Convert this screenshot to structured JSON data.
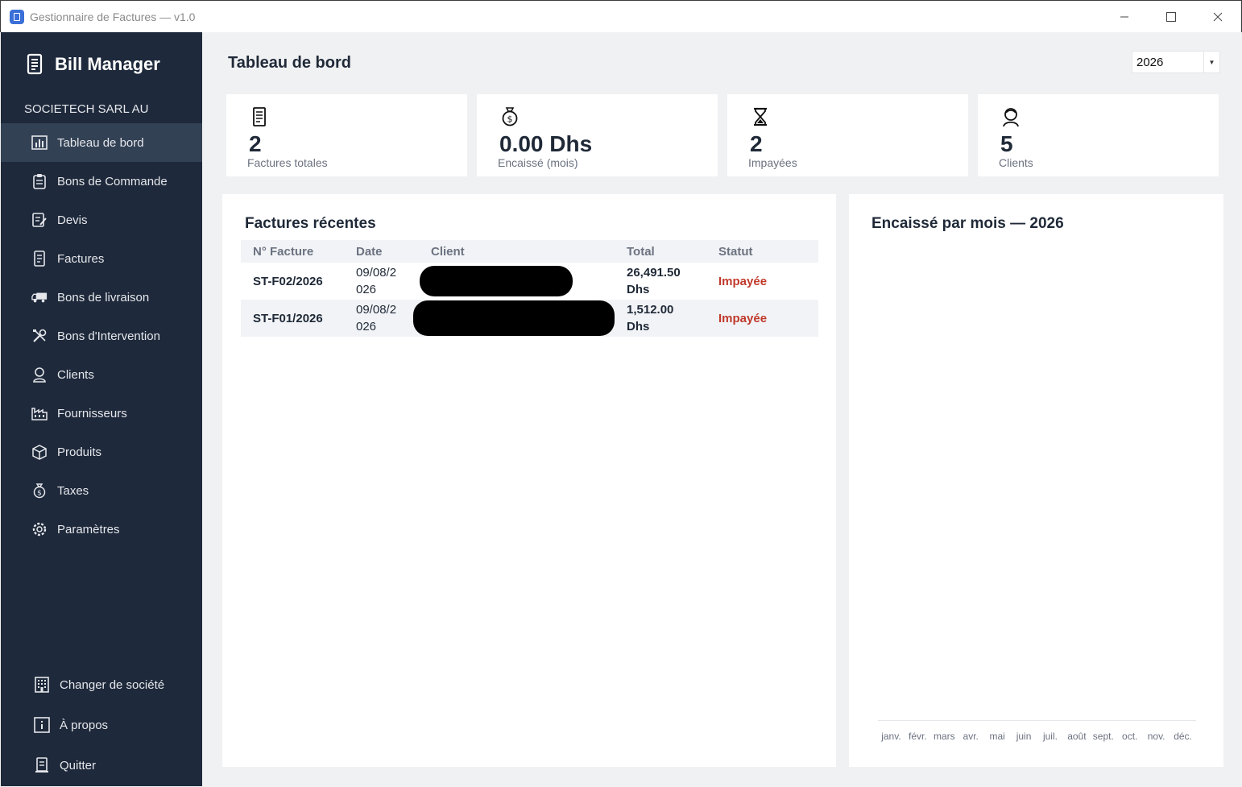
{
  "window": {
    "title": "Gestionnaire de Factures — v1.0",
    "controls": [
      "minimize-icon",
      "maximize-icon",
      "close-icon"
    ]
  },
  "sidebar": {
    "brand": "Bill Manager",
    "company": "SOCIETECH SARL AU",
    "items": [
      {
        "label": "Tableau de bord",
        "icon": "bar-chart-icon",
        "active": true
      },
      {
        "label": "Bons de Commande",
        "icon": "clipboard-icon"
      },
      {
        "label": "Devis",
        "icon": "edit-document-icon"
      },
      {
        "label": "Factures",
        "icon": "invoice-icon"
      },
      {
        "label": "Bons de livraison",
        "icon": "truck-icon"
      },
      {
        "label": "Bons d'Intervention",
        "icon": "tools-icon"
      },
      {
        "label": "Clients",
        "icon": "user-icon"
      },
      {
        "label": "Fournisseurs",
        "icon": "factory-icon"
      },
      {
        "label": "Produits",
        "icon": "box-icon"
      },
      {
        "label": "Taxes",
        "icon": "money-bag-icon"
      },
      {
        "label": "Paramètres",
        "icon": "gear-icon"
      }
    ],
    "bottom_items": [
      {
        "label": "Changer de société",
        "icon": "building-icon"
      },
      {
        "label": "À propos",
        "icon": "info-icon"
      },
      {
        "label": "Quitter",
        "icon": "exit-icon"
      }
    ]
  },
  "header": {
    "title": "Tableau de bord",
    "year": "2026"
  },
  "stats": [
    {
      "value": "2",
      "label": "Factures totales",
      "icon": "invoice-icon"
    },
    {
      "value": "0.00 Dhs",
      "label": "Encaissé (mois)",
      "icon": "money-bag-icon"
    },
    {
      "value": "2",
      "label": "Impayées",
      "icon": "hourglass-icon"
    },
    {
      "value": "5",
      "label": "Clients",
      "icon": "user-icon"
    }
  ],
  "recent": {
    "title": "Factures récentes",
    "columns": [
      "N° Facture",
      "Date",
      "Client",
      "Total",
      "Statut"
    ],
    "rows": [
      {
        "number": "ST-F02/2026",
        "date_a": "09/08/2",
        "date_b": "026",
        "total_a": "26,491.50",
        "total_b": "Dhs",
        "status": "Impayée"
      },
      {
        "number": "ST-F01/2026",
        "date_a": "09/08/2",
        "date_b": "026",
        "total_a": "1,512.00",
        "total_b": "Dhs",
        "status": "Impayée"
      }
    ]
  },
  "colors": {
    "sidebar": "#1e293b",
    "active": "#334155",
    "unpaid": "#c0392b"
  },
  "chart_data": {
    "type": "bar",
    "title": "Encaissé par mois — 2026",
    "categories": [
      "janv.",
      "févr.",
      "mars",
      "avr.",
      "mai",
      "juin",
      "juil.",
      "août",
      "sept.",
      "oct.",
      "nov.",
      "déc."
    ],
    "values": [
      0,
      0,
      0,
      0,
      0,
      0,
      0,
      0,
      0,
      0,
      0,
      0
    ]
  }
}
